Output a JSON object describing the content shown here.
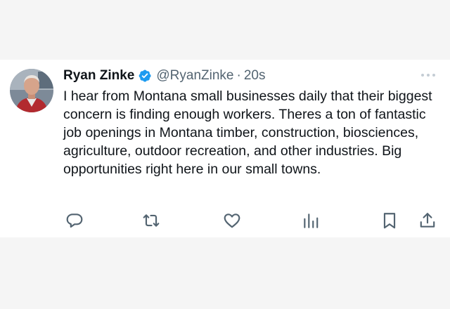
{
  "tweet": {
    "author": {
      "display_name": "Ryan Zinke",
      "handle": "@RyanZinke",
      "verified": true
    },
    "separator": "·",
    "time": "20s",
    "text": "I hear from Montana small businesses daily that their biggest concern is finding enough workers. Theres a ton of fantastic job openings in Montana timber, construction, biosciences, agriculture, outdoor recreation, and other industries. Big opportunities right here in our small towns."
  },
  "actions": [
    {
      "icon": "reply-icon"
    },
    {
      "icon": "retweet-icon"
    },
    {
      "icon": "like-icon"
    },
    {
      "icon": "views-icon"
    },
    {
      "icon": "bookmark-icon"
    },
    {
      "icon": "share-icon"
    }
  ],
  "colors": {
    "background": "#f5f5f5",
    "card": "#ffffff",
    "text_primary": "#0f1419",
    "text_secondary": "#536471",
    "verified_blue": "#1d9bf0"
  }
}
